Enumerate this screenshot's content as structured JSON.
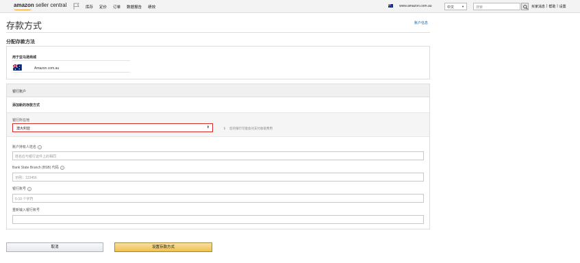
{
  "header": {
    "logo_brand": "amazon",
    "logo_product": " seller central",
    "nav": [
      "库存",
      "定价",
      "订单",
      "数据报告",
      "绩效"
    ],
    "store_url": "www.amazon.com.au",
    "language": "中文",
    "search_placeholder": "搜索",
    "links": [
      "买家消息",
      "帮助",
      "设置"
    ],
    "link_separator": "|"
  },
  "page": {
    "title": "存款方式",
    "account_info_link": "账户信息",
    "section_heading": "分配存款方法"
  },
  "marketplace": {
    "label": "用于亚马逊商城",
    "name": "Amazon.com.au"
  },
  "bank": {
    "header": "银行账户",
    "add_method": "添加新的存款方式",
    "country_label": "银行所在地",
    "country_value": "澳大利亚",
    "info_text": "您的银行可能会对支付收取费用",
    "fields": [
      {
        "label": "账户持有人姓名",
        "placeholder": "姓名应与银行证件上的相同",
        "help": true
      },
      {
        "label": "Bank State Branch (BSB) 代码",
        "placeholder": "示例：123456",
        "help": true
      },
      {
        "label": "银行账号",
        "placeholder": "6-10 个字符",
        "help": true
      },
      {
        "label": "重新输入银行账号",
        "placeholder": "",
        "help": false
      }
    ]
  },
  "actions": {
    "cancel": "取消",
    "submit": "设置存款方式"
  },
  "colors": {
    "link": "#0066c0",
    "highlight_border": "#d62b2b",
    "primary_button": "#f0c14b"
  }
}
